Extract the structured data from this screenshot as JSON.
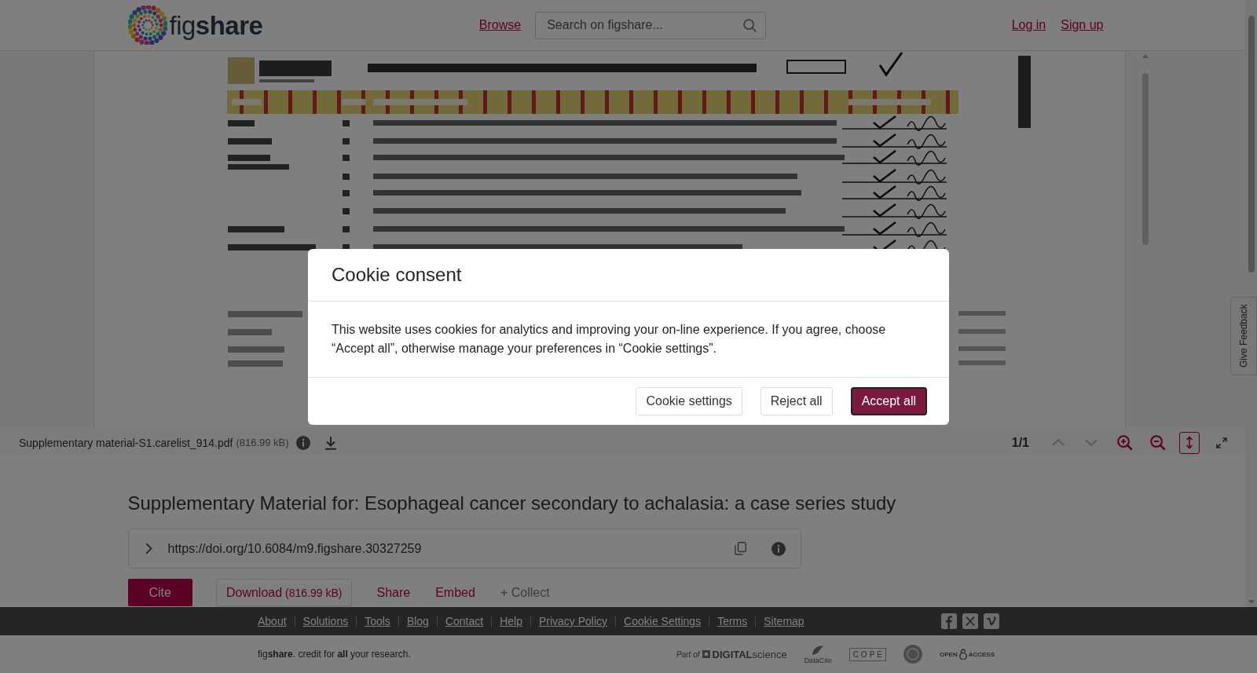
{
  "header": {
    "logo": "fig**share**",
    "nav_link": "Browse",
    "search": {
      "placeholder": "Search on figshare..."
    },
    "auth_links": [
      "Log in",
      "Sign up"
    ]
  },
  "viewer": {
    "file_name": "Supplementary material-S1.carelist_914.pdf",
    "file_size": "(816.99 kB)",
    "page_indicator": "1/1",
    "tools": [
      {
        "kind": "page_up",
        "disabled": true,
        "selected": false
      },
      {
        "kind": "page_down",
        "disabled": true,
        "selected": false
      },
      {
        "kind": "zoom_in",
        "disabled": false,
        "selected": false
      },
      {
        "kind": "zoom_out",
        "disabled": false,
        "selected": false
      },
      {
        "kind": "fit_height",
        "disabled": false,
        "selected": true
      },
      {
        "kind": "fullscreen",
        "disabled": false,
        "selected": false
      }
    ]
  },
  "item": {
    "title": "Supplementary Material for: Esophageal cancer secondary to achalasia: a case series study",
    "doi": "https://doi.org/10.6084/m9.figshare.30327259",
    "actions": [
      {
        "kind": "primary",
        "label": "Cite"
      },
      {
        "kind": "outline",
        "label": "Download",
        "detail": "(816.99 kB)"
      },
      {
        "kind": "link",
        "label": "Share"
      },
      {
        "kind": "link",
        "label": "Embed"
      },
      {
        "kind": "muted",
        "label": "+ Collect"
      }
    ]
  },
  "feedback_tab": "Give Feedback",
  "footer": {
    "links": [
      "About",
      "Solutions",
      "Tools",
      "Blog",
      "Contact",
      "Help",
      "Privacy Policy",
      "Cookie Settings",
      "Terms",
      "Sitemap"
    ],
    "tagline": "fig**share**. credit for **all** your research.",
    "partners": [
      {
        "kind": "digital_science",
        "lead": "Part of",
        "name": "**DIGITAL**science"
      },
      {
        "kind": "datacite",
        "name": "DataCite"
      },
      {
        "kind": "cope",
        "name": "COPE"
      },
      {
        "kind": "seal"
      },
      {
        "kind": "open_access",
        "lead": "OPEN",
        "name": "ACCESS"
      }
    ]
  },
  "cookie_modal": {
    "title": "Cookie consent",
    "body": "This website uses cookies for analytics and improving your on-line experience. If you agree, choose “Accept all”, otherwise manage your preferences in “Cookie settings”.",
    "buttons": [
      {
        "kind": "secondary",
        "label": "Cookie settings"
      },
      {
        "kind": "secondary",
        "label": "Reject all"
      },
      {
        "kind": "primary",
        "label": "Accept all"
      }
    ]
  }
}
